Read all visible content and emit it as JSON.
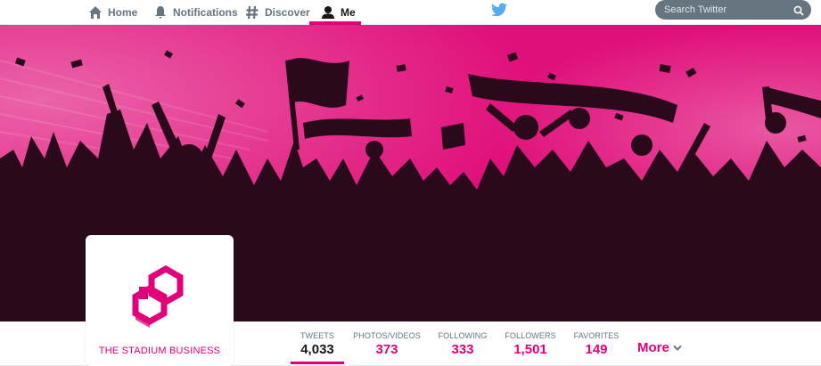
{
  "nav": {
    "items": [
      {
        "label": "Home",
        "icon": "home-icon"
      },
      {
        "label": "Notifications",
        "icon": "bell-icon"
      },
      {
        "label": "Discover",
        "icon": "hashtag-icon"
      },
      {
        "label": "Me",
        "icon": "user-icon",
        "active": true
      }
    ],
    "logo_icon": "twitter-bird-icon",
    "search_placeholder": "Search Twitter"
  },
  "profile": {
    "name": "THE STADIUM BUSINESS",
    "logo_icon": "stadium-business-logo"
  },
  "stats": [
    {
      "label": "TWEETS",
      "value": "4,033",
      "active": true
    },
    {
      "label": "PHOTOS/VIDEOS",
      "value": "373"
    },
    {
      "label": "FOLLOWING",
      "value": "333"
    },
    {
      "label": "FOLLOWERS",
      "value": "1,501"
    },
    {
      "label": "FAVORITES",
      "value": "149"
    }
  ],
  "more_label": "More",
  "colors": {
    "accent": "#e0007a",
    "banner_pink": "#e0107a",
    "silhouette": "#2a0a1a",
    "twitter_blue": "#55acee",
    "search_bg": "#66757f"
  }
}
